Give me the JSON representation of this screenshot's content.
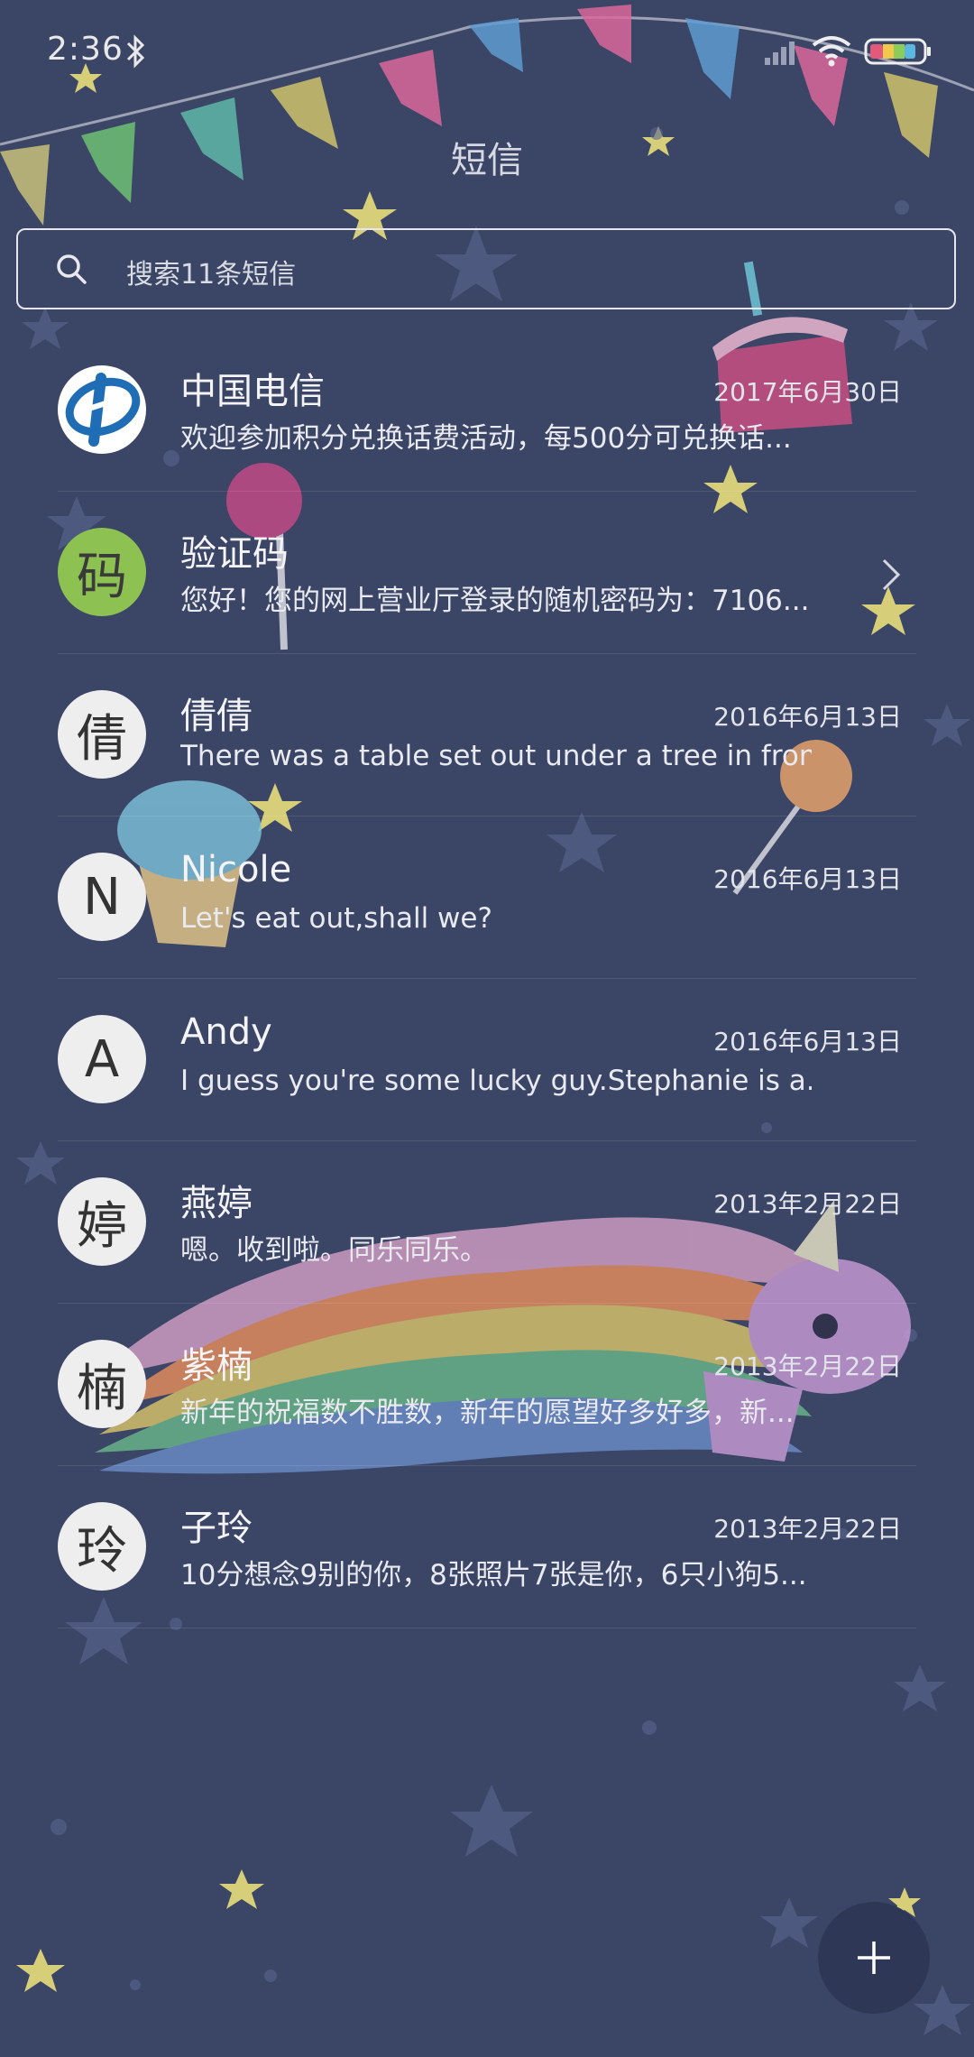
{
  "status_bar": {
    "time": "2:36",
    "icons": [
      "bluetooth-icon",
      "signal-icon",
      "wifi-icon",
      "battery-icon"
    ]
  },
  "header": {
    "title": "短信"
  },
  "search": {
    "placeholder": "搜索11条短信"
  },
  "conversations": [
    {
      "name": "中国电信",
      "date": "2017年6月30日",
      "preview": "欢迎参加积分兑换话费活动，每500分可兑换话...",
      "avatar": "telecom-logo"
    },
    {
      "name": "验证码",
      "date": "",
      "preview": "您好！您的网上营业厅登录的随机密码为：7106...",
      "avatar_text": "码",
      "has_chevron": true
    },
    {
      "name": "倩倩",
      "date": "2016年6月13日",
      "preview": "There was a table set out under a tree in fron...",
      "avatar_text": "倩"
    },
    {
      "name": "Nicole",
      "date": "2016年6月13日",
      "preview": "Let's eat out,shall we?",
      "avatar_text": "N"
    },
    {
      "name": "Andy",
      "date": "2016年6月13日",
      "preview": "I guess you're some lucky guy.Stephanie is a...",
      "avatar_text": "A"
    },
    {
      "name": "燕婷",
      "date": "2013年2月22日",
      "preview": "嗯。收到啦。同乐同乐。",
      "avatar_text": "婷"
    },
    {
      "name": "紫楠",
      "date": "2013年2月22日",
      "preview": "新年的祝福数不胜数，新年的愿望好多好多，新...",
      "avatar_text": "楠"
    },
    {
      "name": "子玲",
      "date": "2013年2月22日",
      "preview": "10分想念9别的你，8张照片7张是你，6只小狗5...",
      "avatar_text": "玲"
    }
  ],
  "fab": {
    "icon": "plus-icon"
  },
  "colors": {
    "background": "#3b4565",
    "fab": "#2e3856",
    "verify_avatar": "#8dc152"
  }
}
